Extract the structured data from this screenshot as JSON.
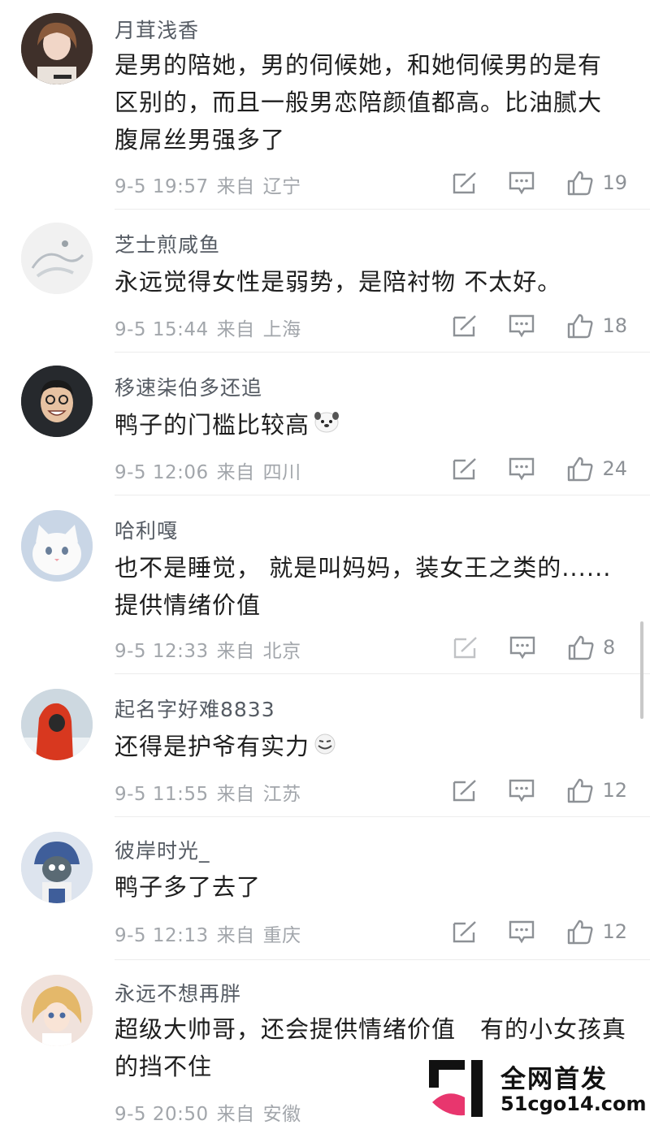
{
  "comments": [
    {
      "username": "月茸浅香",
      "text": "是男的陪她，男的伺候她，和她伺候男的是有区别的，而且一般男恋陪颜值都高。比油腻大腹屌丝男强多了",
      "date": "9-5 19:57",
      "from_label": "来自",
      "location": "辽宁",
      "likes": "19",
      "avatar_icon": "avatar-woman-portrait",
      "avatar_color": "#5a4638"
    },
    {
      "username": "芝士煎咸鱼",
      "text": "永远觉得女性是弱势，是陪衬物 不太好。",
      "date": "9-5 15:44",
      "from_label": "来自",
      "location": "上海",
      "likes": "18",
      "avatar_icon": "avatar-sketch",
      "avatar_color": "#e8e8e8"
    },
    {
      "username": "移速柒伯多还追",
      "text": "鸭子的门槛比较高",
      "date": "9-5 12:06",
      "from_label": "来自",
      "location": "四川",
      "likes": "24",
      "avatar_icon": "avatar-man-laughing",
      "avatar_color": "#2b2b2b",
      "emoji": "dog-face-emoji"
    },
    {
      "username": "哈利嘎",
      "text": "也不是睡觉， 就是叫妈妈，装女王之类的......提供情绪价值",
      "date": "9-5 12:33",
      "from_label": "来自",
      "location": "北京",
      "likes": "8",
      "avatar_icon": "avatar-white-cat",
      "avatar_color": "#dfe3ea"
    },
    {
      "username": "起名字好难8833",
      "text": "还得是护爷有实力",
      "date": "9-5 11:55",
      "from_label": "来自",
      "location": "江苏",
      "likes": "12",
      "avatar_icon": "avatar-red-hood",
      "avatar_color": "#c8d3dc",
      "emoji": "smirk-emoji"
    },
    {
      "username": "彼岸时光_",
      "text": "鸭子多了去了",
      "date": "9-5 12:13",
      "from_label": "来自",
      "location": "重庆",
      "likes": "12",
      "avatar_icon": "avatar-cartoon-girl",
      "avatar_color": "#cfd7e4"
    },
    {
      "username": "永远不想再胖",
      "text": "超级大帅哥，还会提供情绪价值　有的小女孩真的挡不住",
      "date": "9-5 20:50",
      "from_label": "来自",
      "location": "安徽",
      "likes": "",
      "avatar_icon": "avatar-anime-girl",
      "avatar_color": "#e6d6cc"
    }
  ],
  "watermark": {
    "title": "全网首发",
    "url": "51cgo14.com"
  },
  "colors": {
    "username": "#555b63",
    "text": "#1e1e1e",
    "meta": "#a2a6ab",
    "icon": "#8d9196"
  }
}
